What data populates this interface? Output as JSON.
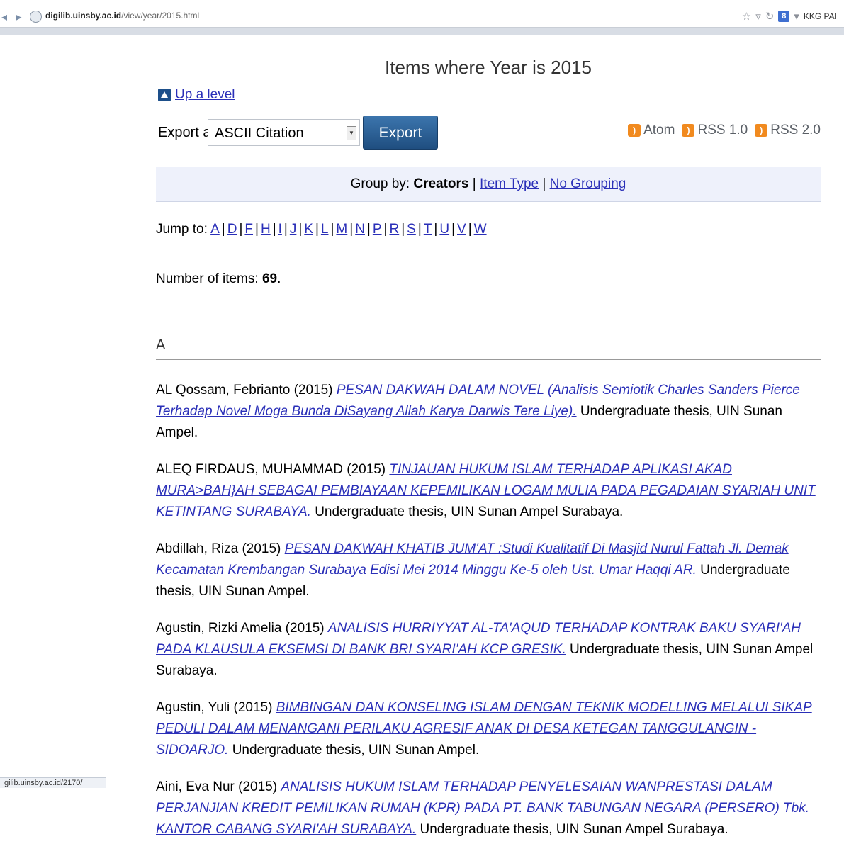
{
  "browser": {
    "url_domain": "digilib.uinsby.ac.id",
    "url_path": "/view/year/2015.html",
    "search_engine_label": "KKG PAI",
    "status_url": "gilib.uinsby.ac.id/2170/"
  },
  "page": {
    "title": "Items where Year is 2015",
    "up_level": "Up a level",
    "export_label": "Export as",
    "export_selected": "ASCII Citation",
    "export_button": "Export",
    "feeds": [
      "Atom",
      "RSS 1.0",
      "RSS 2.0"
    ],
    "group_by_label": "Group by:",
    "group_current": "Creators",
    "group_options": [
      "Item Type",
      "No Grouping"
    ],
    "jump_label": "Jump to:",
    "jump_letters": [
      "A",
      "D",
      "F",
      "H",
      "I",
      "J",
      "K",
      "L",
      "M",
      "N",
      "P",
      "R",
      "S",
      "T",
      "U",
      "V",
      "W"
    ],
    "count_label": "Number of items:",
    "count_value": "69",
    "section_letter": "A"
  },
  "items": [
    {
      "author": "AL Qossam, Febrianto (2015)",
      "title": "PESAN DAKWAH DALAM NOVEL  (Analisis Semiotik Charles Sanders Pierce Terhadap Novel Moga Bunda DiSayang Allah Karya Darwis Tere Liye).",
      "tail": "Undergraduate thesis, UIN Sunan Ampel."
    },
    {
      "author": "ALEQ FIRDAUS, MUHAMMAD (2015)",
      "title": "TINJAUAN HUKUM ISLAM TERHADAP APLIKASI AKAD  MURA>BAH}AH SEBAGAI PEMBIAYAAN KEPEMILIKAN LOGAM MULIA PADA PEGADAIAN SYARIAH UNIT KETINTANG SURABAYA.",
      "tail": "Undergraduate thesis, UIN Sunan Ampel Surabaya."
    },
    {
      "author": "Abdillah, Riza (2015)",
      "title": "PESAN DAKWAH KHATIB JUM'AT :Studi Kualitatif Di Masjid Nurul Fattah Jl. Demak Kecamatan Krembangan Surabaya Edisi Mei 2014 Minggu Ke-5 oleh Ust. Umar Haqqi AR.",
      "tail": "Undergraduate thesis, UIN Sunan Ampel."
    },
    {
      "author": "Agustin, Rizki Amelia (2015)",
      "title": "ANALISIS HURRIYYAT AL-TA'AQUD TERHADAP KONTRAK BAKU SYARI'AH PADA KLAUSULA EKSEMSI DI BANK BRI SYARI'AH KCP GRESIK.",
      "tail": "Undergraduate thesis, UIN Sunan Ampel Surabaya."
    },
    {
      "author": "Agustin, Yuli (2015)",
      "title": "BIMBINGAN DAN KONSELING ISLAM DENGAN TEKNIK MODELLING MELALUI SIKAP PEDULI DALAM MENANGANI PERILAKU AGRESIF ANAK DI DESA KETEGAN TANGGULANGIN - SIDOARJO.",
      "tail": "Undergraduate thesis, UIN Sunan Ampel."
    },
    {
      "author": "Aini, Eva Nur (2015)",
      "title": "ANALISIS HUKUM ISLAM TERHADAP PENYELESAIAN WANPRESTASI DALAM PERJANJIAN KREDIT PEMILIKAN  RUMAH (KPR) PADA PT. BANK TABUNGAN NEGARA (PERSERO) Tbk. KANTOR CABANG SYARI'AH SURABAYA.",
      "tail": "Undergraduate thesis, UIN Sunan Ampel Surabaya."
    }
  ]
}
